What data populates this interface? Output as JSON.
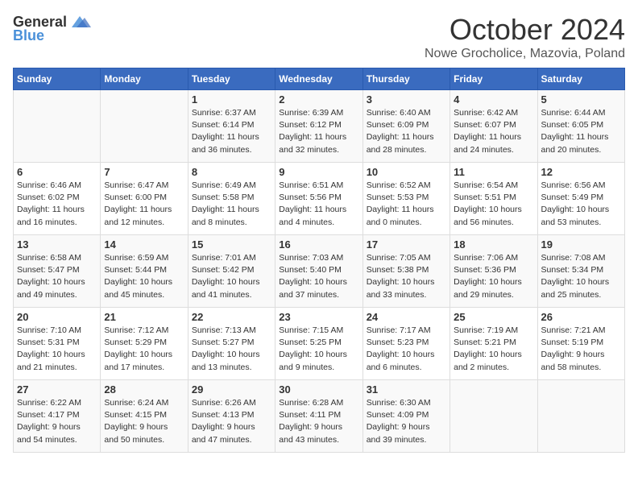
{
  "header": {
    "logo_general": "General",
    "logo_blue": "Blue",
    "month": "October 2024",
    "location": "Nowe Grocholice, Mazovia, Poland"
  },
  "days_of_week": [
    "Sunday",
    "Monday",
    "Tuesday",
    "Wednesday",
    "Thursday",
    "Friday",
    "Saturday"
  ],
  "weeks": [
    [
      {
        "date": "",
        "info": ""
      },
      {
        "date": "",
        "info": ""
      },
      {
        "date": "1",
        "info": "Sunrise: 6:37 AM\nSunset: 6:14 PM\nDaylight: 11 hours\nand 36 minutes."
      },
      {
        "date": "2",
        "info": "Sunrise: 6:39 AM\nSunset: 6:12 PM\nDaylight: 11 hours\nand 32 minutes."
      },
      {
        "date": "3",
        "info": "Sunrise: 6:40 AM\nSunset: 6:09 PM\nDaylight: 11 hours\nand 28 minutes."
      },
      {
        "date": "4",
        "info": "Sunrise: 6:42 AM\nSunset: 6:07 PM\nDaylight: 11 hours\nand 24 minutes."
      },
      {
        "date": "5",
        "info": "Sunrise: 6:44 AM\nSunset: 6:05 PM\nDaylight: 11 hours\nand 20 minutes."
      }
    ],
    [
      {
        "date": "6",
        "info": "Sunrise: 6:46 AM\nSunset: 6:02 PM\nDaylight: 11 hours\nand 16 minutes."
      },
      {
        "date": "7",
        "info": "Sunrise: 6:47 AM\nSunset: 6:00 PM\nDaylight: 11 hours\nand 12 minutes."
      },
      {
        "date": "8",
        "info": "Sunrise: 6:49 AM\nSunset: 5:58 PM\nDaylight: 11 hours\nand 8 minutes."
      },
      {
        "date": "9",
        "info": "Sunrise: 6:51 AM\nSunset: 5:56 PM\nDaylight: 11 hours\nand 4 minutes."
      },
      {
        "date": "10",
        "info": "Sunrise: 6:52 AM\nSunset: 5:53 PM\nDaylight: 11 hours\nand 0 minutes."
      },
      {
        "date": "11",
        "info": "Sunrise: 6:54 AM\nSunset: 5:51 PM\nDaylight: 10 hours\nand 56 minutes."
      },
      {
        "date": "12",
        "info": "Sunrise: 6:56 AM\nSunset: 5:49 PM\nDaylight: 10 hours\nand 53 minutes."
      }
    ],
    [
      {
        "date": "13",
        "info": "Sunrise: 6:58 AM\nSunset: 5:47 PM\nDaylight: 10 hours\nand 49 minutes."
      },
      {
        "date": "14",
        "info": "Sunrise: 6:59 AM\nSunset: 5:44 PM\nDaylight: 10 hours\nand 45 minutes."
      },
      {
        "date": "15",
        "info": "Sunrise: 7:01 AM\nSunset: 5:42 PM\nDaylight: 10 hours\nand 41 minutes."
      },
      {
        "date": "16",
        "info": "Sunrise: 7:03 AM\nSunset: 5:40 PM\nDaylight: 10 hours\nand 37 minutes."
      },
      {
        "date": "17",
        "info": "Sunrise: 7:05 AM\nSunset: 5:38 PM\nDaylight: 10 hours\nand 33 minutes."
      },
      {
        "date": "18",
        "info": "Sunrise: 7:06 AM\nSunset: 5:36 PM\nDaylight: 10 hours\nand 29 minutes."
      },
      {
        "date": "19",
        "info": "Sunrise: 7:08 AM\nSunset: 5:34 PM\nDaylight: 10 hours\nand 25 minutes."
      }
    ],
    [
      {
        "date": "20",
        "info": "Sunrise: 7:10 AM\nSunset: 5:31 PM\nDaylight: 10 hours\nand 21 minutes."
      },
      {
        "date": "21",
        "info": "Sunrise: 7:12 AM\nSunset: 5:29 PM\nDaylight: 10 hours\nand 17 minutes."
      },
      {
        "date": "22",
        "info": "Sunrise: 7:13 AM\nSunset: 5:27 PM\nDaylight: 10 hours\nand 13 minutes."
      },
      {
        "date": "23",
        "info": "Sunrise: 7:15 AM\nSunset: 5:25 PM\nDaylight: 10 hours\nand 9 minutes."
      },
      {
        "date": "24",
        "info": "Sunrise: 7:17 AM\nSunset: 5:23 PM\nDaylight: 10 hours\nand 6 minutes."
      },
      {
        "date": "25",
        "info": "Sunrise: 7:19 AM\nSunset: 5:21 PM\nDaylight: 10 hours\nand 2 minutes."
      },
      {
        "date": "26",
        "info": "Sunrise: 7:21 AM\nSunset: 5:19 PM\nDaylight: 9 hours\nand 58 minutes."
      }
    ],
    [
      {
        "date": "27",
        "info": "Sunrise: 6:22 AM\nSunset: 4:17 PM\nDaylight: 9 hours\nand 54 minutes."
      },
      {
        "date": "28",
        "info": "Sunrise: 6:24 AM\nSunset: 4:15 PM\nDaylight: 9 hours\nand 50 minutes."
      },
      {
        "date": "29",
        "info": "Sunrise: 6:26 AM\nSunset: 4:13 PM\nDaylight: 9 hours\nand 47 minutes."
      },
      {
        "date": "30",
        "info": "Sunrise: 6:28 AM\nSunset: 4:11 PM\nDaylight: 9 hours\nand 43 minutes."
      },
      {
        "date": "31",
        "info": "Sunrise: 6:30 AM\nSunset: 4:09 PM\nDaylight: 9 hours\nand 39 minutes."
      },
      {
        "date": "",
        "info": ""
      },
      {
        "date": "",
        "info": ""
      }
    ]
  ]
}
